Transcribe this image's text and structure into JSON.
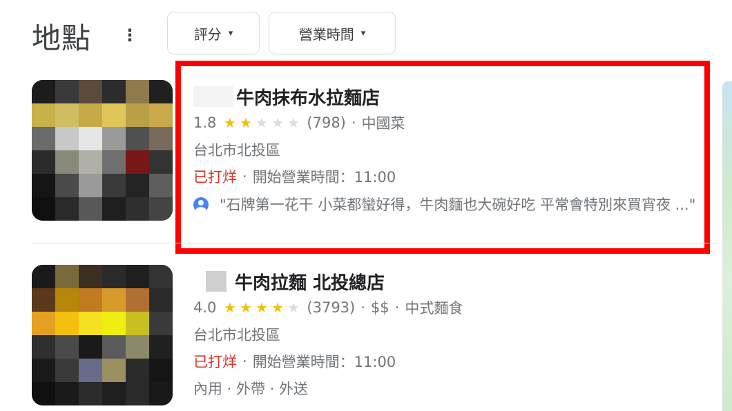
{
  "header": {
    "title": "地點",
    "more_icon": "⋮",
    "chips": [
      {
        "label": "評分",
        "icon": "▾"
      },
      {
        "label": "營業時間",
        "icon": "▾"
      }
    ]
  },
  "listings": [
    {
      "name": "牛肉抹布水拉麵店",
      "rating": "1.8",
      "stars": 2,
      "reviews": "(798)",
      "price": "",
      "category": "中國菜",
      "address": "台北市北投區",
      "status": "已打烊",
      "hours": "開始營業時間：11:00",
      "review": "\"石牌第一花干 小菜都蠻好得，牛肉麵也大碗好吃 平常會特別來買宵夜 ...\"",
      "highlighted": true
    },
    {
      "name": "牛肉拉麵 北投總店",
      "rating": "4.0",
      "stars": 4,
      "reviews": "(3793)",
      "price": "$$",
      "category": "中式麵食",
      "address": "台北市北投區",
      "status": "已打烊",
      "hours": "開始營業時間：11:00",
      "services": "內用 · 外帶 · 外送",
      "highlighted": false
    }
  ],
  "colors": {
    "star_on": "#fbbc04",
    "star_off": "#dadce0",
    "closed": "#d93025",
    "highlight_border": "#ff0000"
  }
}
